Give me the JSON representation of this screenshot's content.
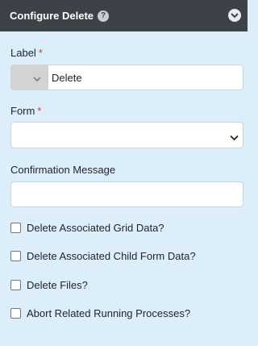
{
  "header": {
    "title": "Configure Delete",
    "help_icon": "?"
  },
  "label_field": {
    "label": "Label",
    "required_mark": "*",
    "value": "Delete"
  },
  "form_field": {
    "label": "Form",
    "required_mark": "*",
    "selected": ""
  },
  "confirmation_field": {
    "label": "Confirmation Message",
    "value": ""
  },
  "checkboxes": [
    {
      "label": "Delete Associated Grid Data?",
      "checked": false
    },
    {
      "label": "Delete Associated Child Form Data?",
      "checked": false
    },
    {
      "label": "Delete Files?",
      "checked": false
    },
    {
      "label": "Abort Related Running Processes?",
      "checked": false
    }
  ],
  "colors": {
    "header_bg": "#3c4247",
    "panel_bg": "#ddeefb",
    "required": "#dc3545"
  }
}
